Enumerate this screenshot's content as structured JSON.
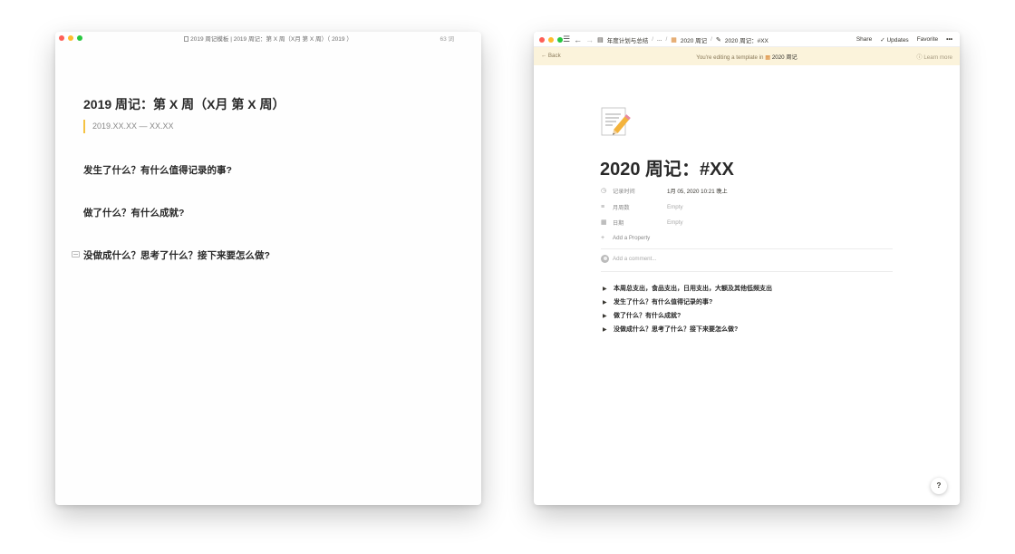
{
  "colors": {
    "traffic_red": "#fe5f57",
    "traffic_yellow": "#febc2e",
    "traffic_green": "#28c840",
    "quote_bar": "#f5c242",
    "template_banner": "#fbf3db"
  },
  "left_window": {
    "title": "2019 周记模板 | 2019 周记：第 X 周（X月 第 X 周）（ 2019 ）",
    "word_count": "63 词",
    "heading": "2019 周记：第 X 周（X月 第 X 周）",
    "date_range": "2019.XX.XX — XX.XX",
    "sections": [
      "发生了什么？有什么值得记录的事?",
      "做了什么？有什么成就?",
      "没做成什么？思考了什么？接下来要怎么做?"
    ]
  },
  "right_window": {
    "breadcrumbs": {
      "workspace": "年度计划与总结",
      "ellipsis": "...",
      "parent": "2020 周记",
      "page": "2020 周记：#XX"
    },
    "actions": {
      "share": "Share",
      "updates": "Updates",
      "favorite": "Favorite",
      "more": "•••"
    },
    "banner": {
      "back": "Back",
      "editing_text": "You're editing a template in",
      "template_db": "2020 周记",
      "learn_more": "Learn more"
    },
    "page_icon": "memo-icon",
    "page_title": "2020 周记：#XX",
    "properties": [
      {
        "icon": "clock-icon",
        "name": "记录时间",
        "value": "1月 05, 2020 10:21 晚上"
      },
      {
        "icon": "text-icon",
        "name": "月周数",
        "value": "Empty"
      },
      {
        "icon": "calendar-icon",
        "name": "日期",
        "value": "Empty"
      }
    ],
    "add_property": "Add a Property",
    "add_comment": "Add a comment...",
    "toggles": [
      {
        "text": "本周总支出，食品支出，日用支出，大额及其他低频支出",
        "expanded": false
      },
      {
        "text": "发生了什么？有什么值得记录的事?",
        "expanded": false
      },
      {
        "text": "做了什么？有什么成就?",
        "expanded": false
      },
      {
        "text": "没做成什么？思考了什么？接下来要怎么做?",
        "expanded": false
      }
    ],
    "help": "?"
  }
}
